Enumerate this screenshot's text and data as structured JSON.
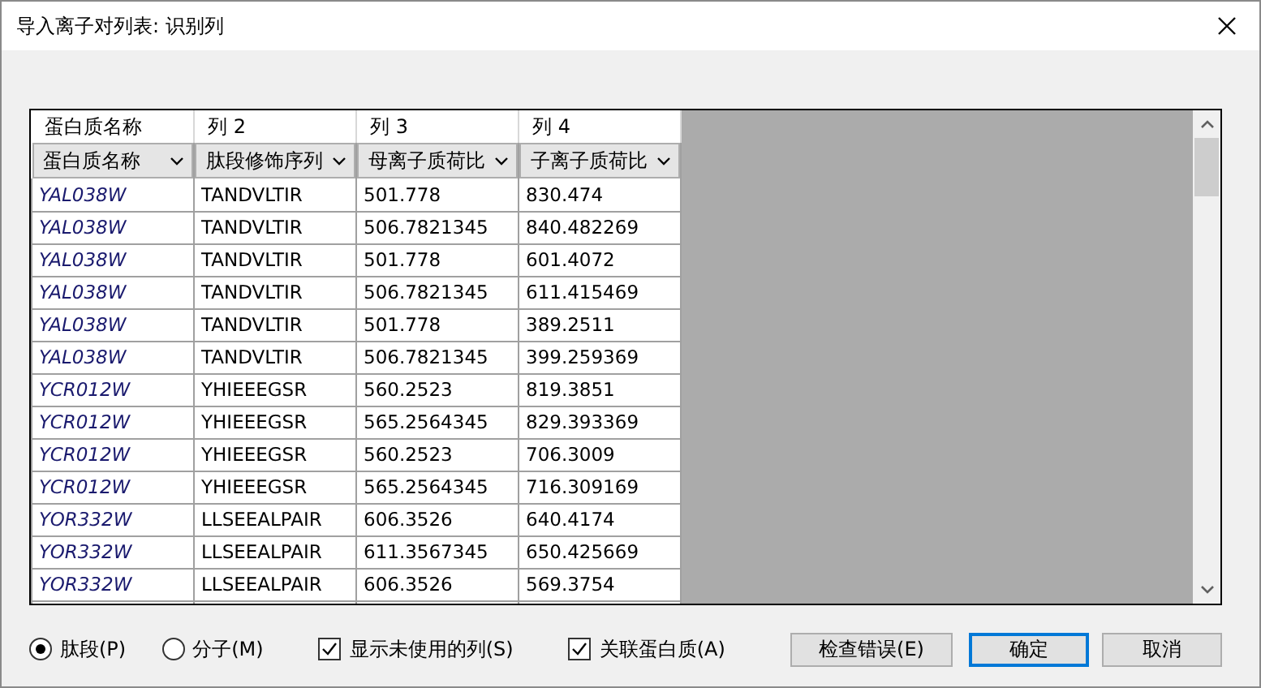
{
  "window": {
    "title": "导入离子对列表: 识别列"
  },
  "table": {
    "columns": [
      {
        "name": "蛋白质名称",
        "mapping": "蛋白质名称"
      },
      {
        "name": "列 2",
        "mapping": "肽段修饰序列"
      },
      {
        "name": "列 3",
        "mapping": "母离子质荷比"
      },
      {
        "name": "列 4",
        "mapping": "子离子质荷比"
      }
    ],
    "rows": [
      [
        "YAL038W",
        "TANDVLTIR",
        "501.778",
        "830.474"
      ],
      [
        "YAL038W",
        "TANDVLTIR",
        "506.7821345",
        "840.482269"
      ],
      [
        "YAL038W",
        "TANDVLTIR",
        "501.778",
        "601.4072"
      ],
      [
        "YAL038W",
        "TANDVLTIR",
        "506.7821345",
        "611.415469"
      ],
      [
        "YAL038W",
        "TANDVLTIR",
        "501.778",
        "389.2511"
      ],
      [
        "YAL038W",
        "TANDVLTIR",
        "506.7821345",
        "399.259369"
      ],
      [
        "YCR012W",
        "YHIEEEGSR",
        "560.2523",
        "819.3851"
      ],
      [
        "YCR012W",
        "YHIEEEGSR",
        "565.2564345",
        "829.393369"
      ],
      [
        "YCR012W",
        "YHIEEEGSR",
        "560.2523",
        "706.3009"
      ],
      [
        "YCR012W",
        "YHIEEEGSR",
        "565.2564345",
        "716.309169"
      ],
      [
        "YOR332W",
        "LLSEEALPAIR",
        "606.3526",
        "640.4174"
      ],
      [
        "YOR332W",
        "LLSEEALPAIR",
        "611.3567345",
        "650.425669"
      ],
      [
        "YOR332W",
        "LLSEEALPAIR",
        "606.3526",
        "569.3754"
      ]
    ]
  },
  "options": [
    {
      "kind": "radio",
      "label": "肽段(P)",
      "selected": true
    },
    {
      "kind": "radio",
      "label": "分子(M)",
      "selected": false
    },
    {
      "kind": "checkbox",
      "label": "显示未使用的列(S)",
      "checked": true
    },
    {
      "kind": "checkbox",
      "label": "关联蛋白质(A)",
      "checked": true
    }
  ],
  "buttons": [
    {
      "label": "检查错误(E)",
      "default": false
    },
    {
      "label": "确定",
      "default": true
    },
    {
      "label": "取消",
      "default": false
    }
  ]
}
